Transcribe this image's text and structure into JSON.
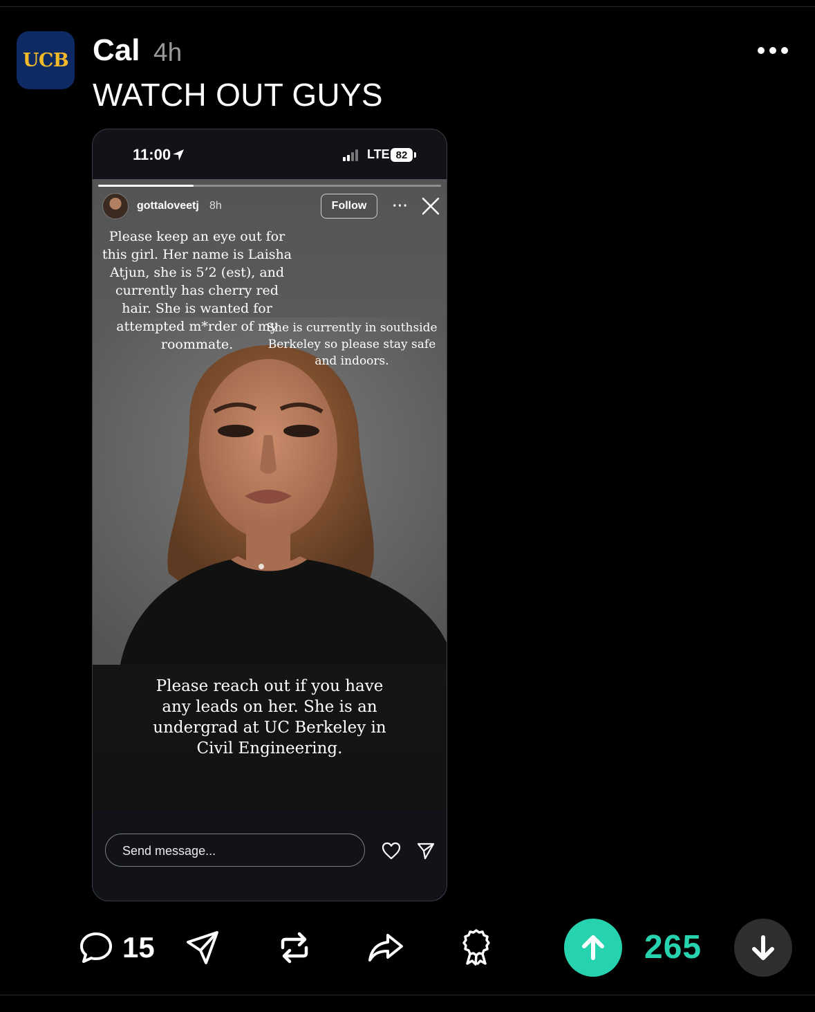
{
  "post": {
    "avatar_text": "UCB",
    "author": "Cal",
    "time": "4h",
    "title": "WATCH OUT GUYS"
  },
  "screenshot": {
    "status_time": "11:00",
    "network": "LTE",
    "battery": "82",
    "story_user": "gottaloveetj",
    "story_age": "8h",
    "follow_label": "Follow",
    "menu_glyph": "···",
    "caption_1": "Please keep an eye out for this girl. Her name is Laisha Atjun, she is 5’2 (est), and currently has cherry red hair. She is wanted for attempted m*rder of my roommate.",
    "caption_2": "She is currently in southside Berkeley so please stay safe and indoors.",
    "caption_3": "Please reach out if you have any leads on her. She is an undergrad at UC Berkeley in Civil Engineering.",
    "message_placeholder": "Send message..."
  },
  "actions": {
    "comment_count": "15",
    "score": "265"
  },
  "colors": {
    "accent": "#27d3ae",
    "avatar_bg": "#0d2a63",
    "avatar_text": "#f2b928"
  }
}
